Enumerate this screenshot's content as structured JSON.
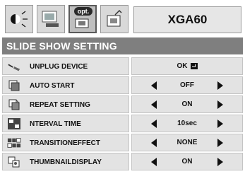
{
  "header": {
    "tabs": [
      {
        "icon": "picture-adjust-icon"
      },
      {
        "icon": "image-adjust-icon"
      },
      {
        "icon": "option-icon",
        "badge": "opt."
      },
      {
        "icon": "setting-icon"
      }
    ],
    "model": "XGA60"
  },
  "section_title": "SLIDE SHOW SETTING",
  "rows": [
    {
      "icon": "unplug-device-icon",
      "label": "UNPLUG DEVICE",
      "value": "OK",
      "control": "enter"
    },
    {
      "icon": "auto-start-icon",
      "label": "AUTO START",
      "value": "OFF",
      "control": "arrows"
    },
    {
      "icon": "repeat-setting-icon",
      "label": "REPEAT SETTING",
      "value": "ON",
      "control": "arrows"
    },
    {
      "icon": "interval-time-icon",
      "label": "NTERVAL TIME",
      "value": "10sec",
      "control": "arrows"
    },
    {
      "icon": "transition-effect-icon",
      "label_lines": [
        "TRANSITION",
        "EFFECT"
      ],
      "value": "NONE",
      "control": "arrows"
    },
    {
      "icon": "thumbnail-display-icon",
      "label_lines": [
        "THUMBNAIL",
        "DISPLAY"
      ],
      "value": "ON",
      "control": "arrows"
    }
  ]
}
